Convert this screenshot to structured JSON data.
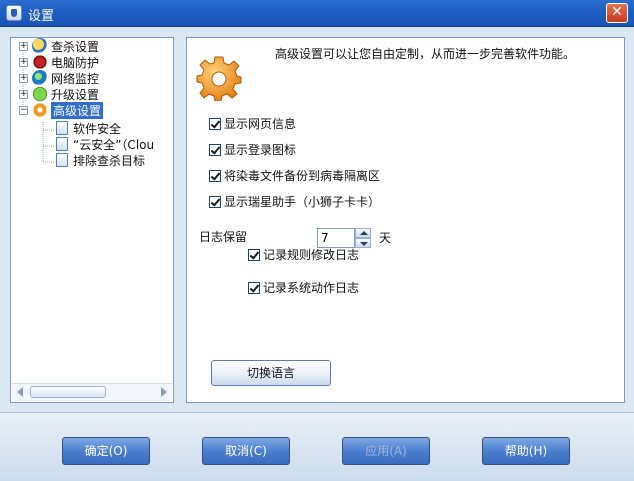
{
  "window": {
    "title": "设置"
  },
  "tree": {
    "items": [
      {
        "label": "查杀设置",
        "icon": "search-shield-icon"
      },
      {
        "label": "电脑防护",
        "icon": "protection-icon"
      },
      {
        "label": "网络监控",
        "icon": "network-globe-icon"
      },
      {
        "label": "升级设置",
        "icon": "update-arrow-icon"
      },
      {
        "label": "高级设置",
        "icon": "gear-icon",
        "selected": true
      }
    ],
    "children": [
      {
        "label": "软件安全"
      },
      {
        "label": "“云安全”（Clou"
      },
      {
        "label": "排除查杀目标"
      }
    ]
  },
  "panel": {
    "description": "高级设置可以让您自由定制，从而进一步完善软件功能。",
    "options": [
      {
        "label": "显示网页信息",
        "checked": true
      },
      {
        "label": "显示登录图标",
        "checked": true
      },
      {
        "label": "将染毒文件备份到病毒隔离区",
        "checked": true
      },
      {
        "label": "显示瑞星助手（小狮子卡卡）",
        "checked": true
      }
    ],
    "log_keep_label": "日志保留",
    "log_keep_value": "7",
    "log_keep_unit": "天",
    "log_options": [
      {
        "label": "记录规则修改日志",
        "checked": true
      },
      {
        "label": "记录系统动作日志",
        "checked": true
      }
    ],
    "switch_language": "切换语言"
  },
  "footer": {
    "ok": "确定(O)",
    "cancel": "取消(C)",
    "apply": "应用(A)",
    "help": "帮助(H)"
  },
  "colors": {
    "titlebar": "#1f5fc4",
    "selection": "#2f6fcb",
    "dialog_button": "#4d7fd0"
  }
}
